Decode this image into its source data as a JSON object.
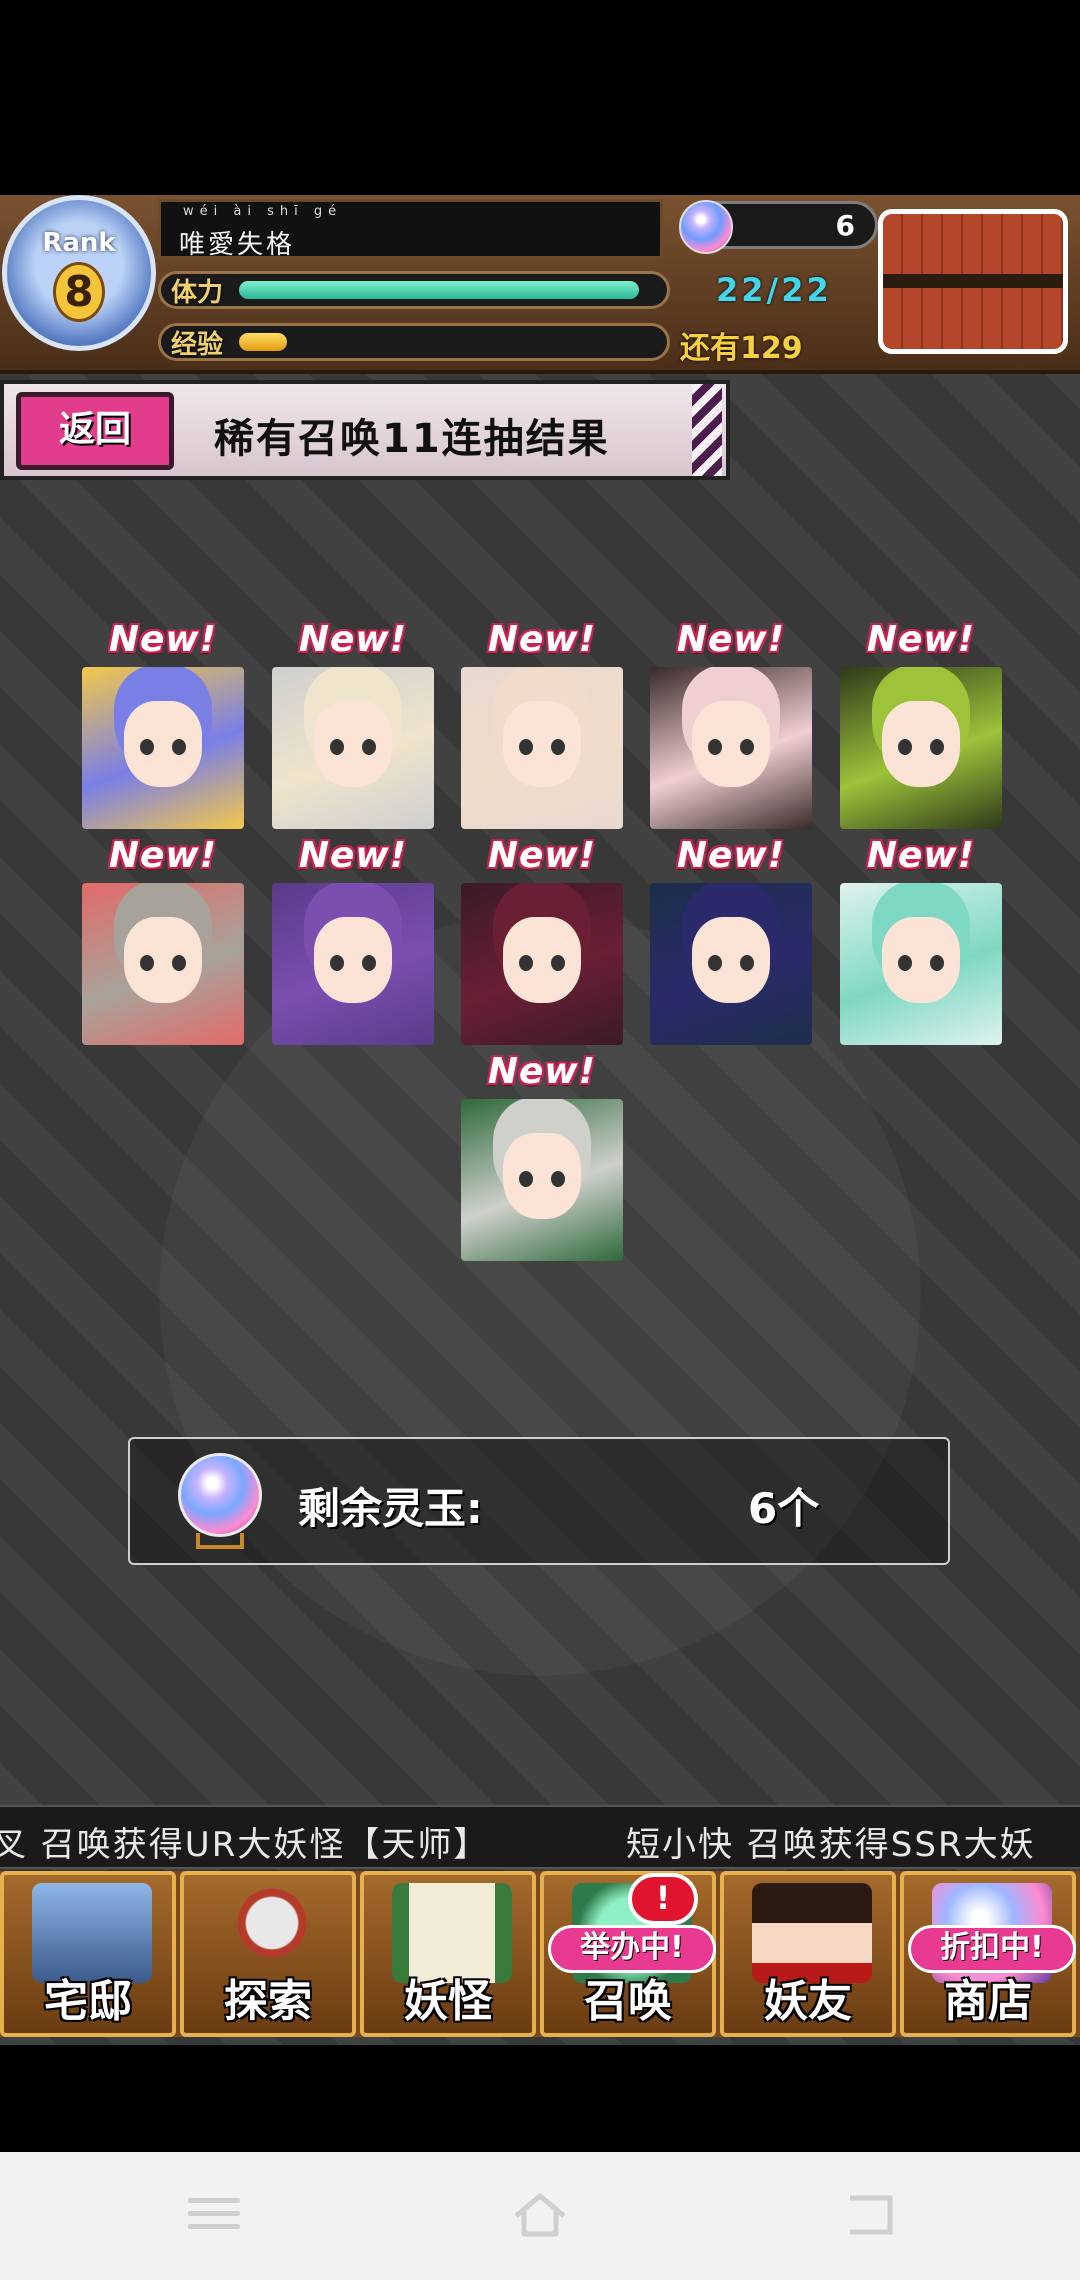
{
  "header": {
    "rank_label": "Rank",
    "rank_value": "8",
    "player_name_ruby": "wéi ài shī gé",
    "player_name": "唯愛失格",
    "stamina_label": "体力",
    "stamina_value": "22/22",
    "stamina_progress": 1.0,
    "exp_label": "经验",
    "exp_remaining": "还有129",
    "exp_progress": 0.12,
    "gem_count": "6"
  },
  "title_bar": {
    "back_label": "返回",
    "title": "稀有召唤11连抽结果"
  },
  "results": {
    "new_label": "New!",
    "cards": [
      {
        "hair": "#7a7fe6",
        "bg": "#f3c84a"
      },
      {
        "hair": "#efe4cc",
        "bg": "#cfcfcf"
      },
      {
        "hair": "#f1dccb",
        "bg": "#e8d8cf"
      },
      {
        "hair": "#f0cfd2",
        "bg": "#3a2a2a"
      },
      {
        "hair": "#9cc33a",
        "bg": "#2e3a1a"
      },
      {
        "hair": "#a8a39a",
        "bg": "#e26a6a"
      },
      {
        "hair": "#7a4fb0",
        "bg": "#5b3a8a"
      },
      {
        "hair": "#6a1f34",
        "bg": "#3a1a2a"
      },
      {
        "hair": "#2a2a6a",
        "bg": "#1c2f4a"
      },
      {
        "hair": "#7fd8c4",
        "bg": "#dff2ee"
      },
      {
        "hair": "#cfd0cc",
        "bg": "#2e6a3a"
      }
    ]
  },
  "remaining": {
    "label": "剩余灵玉:",
    "value": "6个"
  },
  "ticker": {
    "text_1": "叉 召唤获得UR大妖怪【天师】",
    "text_2": "短小快 召唤获得SSR大妖"
  },
  "nav": {
    "items": [
      {
        "label": "宅邸",
        "icon": "mansion-icon"
      },
      {
        "label": "探索",
        "icon": "magnifier-icon"
      },
      {
        "label": "妖怪",
        "icon": "scroll-icon"
      },
      {
        "label": "召唤",
        "icon": "star-icon",
        "badge": "举办中!",
        "alert": "!"
      },
      {
        "label": "妖友",
        "icon": "catgirl-icon"
      },
      {
        "label": "商店",
        "icon": "orb-icon",
        "badge": "折扣中!"
      }
    ]
  },
  "colors": {
    "accent_pink": "#e23d8c",
    "stamina": "#2ab896",
    "exp": "#e39a12"
  }
}
